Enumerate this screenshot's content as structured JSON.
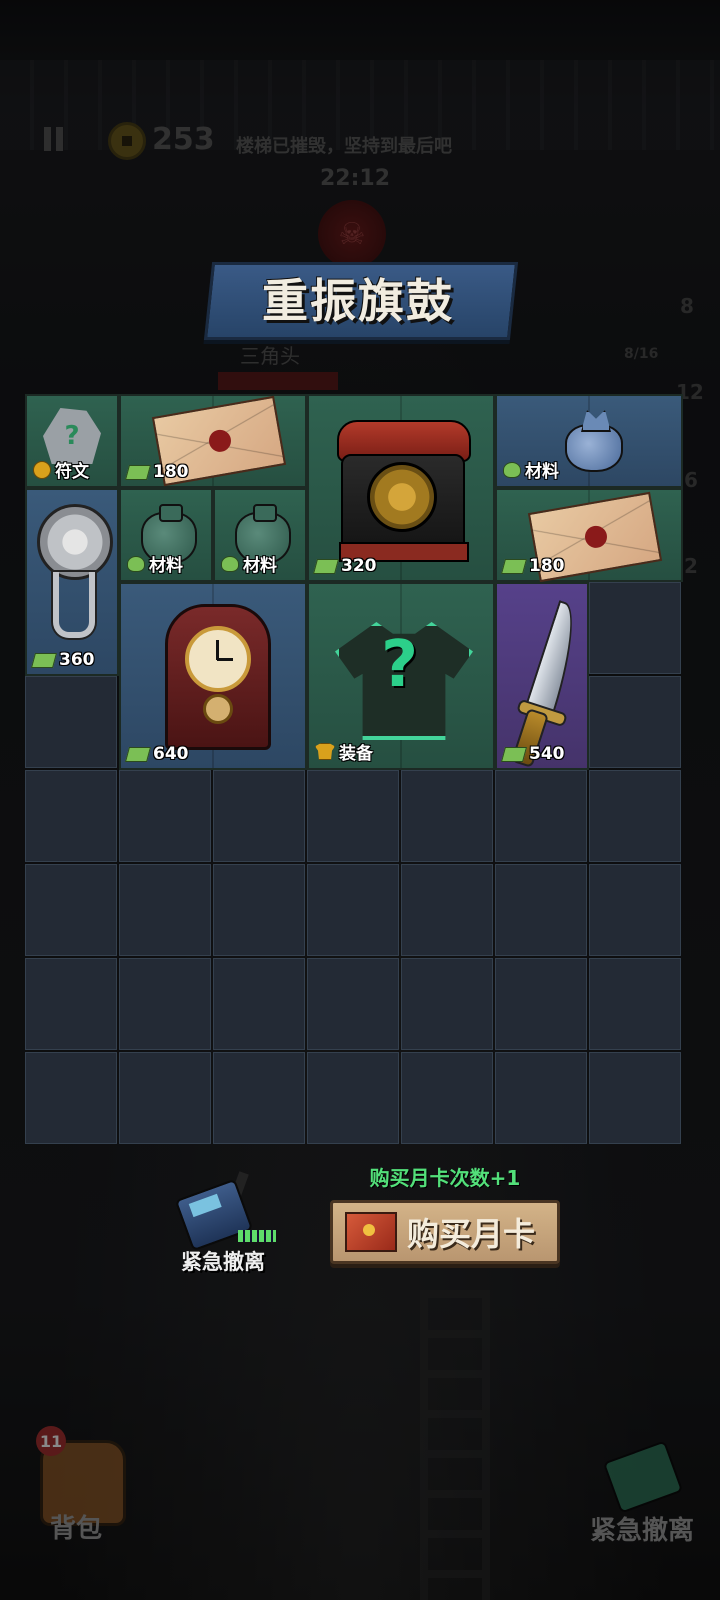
{
  "hud": {
    "coins": "253",
    "notice": "楼梯已摧毁，坚持到最后吧",
    "timer": "22:12",
    "enemy_name": "三角头",
    "side_counts": [
      "8",
      "8/16",
      "12",
      "6",
      "2"
    ]
  },
  "banner": {
    "title": "重振旗鼓"
  },
  "grid": {
    "columns": 7,
    "rows": 8
  },
  "items": {
    "rune": {
      "tag": "符文",
      "rarity": "green",
      "icon": "rune-stone-icon",
      "tag_icon": "gold-coin-icon"
    },
    "letter1": {
      "price": "180",
      "rarity": "green",
      "icon": "bloody-letter-icon",
      "tag_icon": "cash-icon"
    },
    "telephone": {
      "price": "320",
      "rarity": "green",
      "icon": "rotary-telephone-icon",
      "tag_icon": "cash-icon"
    },
    "bluebag": {
      "tag": "材料",
      "rarity": "blue",
      "icon": "blue-sack-icon",
      "tag_icon": "material-icon"
    },
    "bookmark": {
      "price": "360",
      "rarity": "blue",
      "icon": "silver-bookmark-icon",
      "tag_icon": "cash-icon"
    },
    "sack1": {
      "tag": "材料",
      "rarity": "green",
      "icon": "green-sack-icon",
      "tag_icon": "material-icon"
    },
    "sack2": {
      "tag": "材料",
      "rarity": "green",
      "icon": "green-sack-icon",
      "tag_icon": "material-icon"
    },
    "letter2": {
      "price": "180",
      "rarity": "green",
      "icon": "bloody-letter-icon",
      "tag_icon": "cash-icon"
    },
    "clock": {
      "price": "640",
      "rarity": "blue",
      "icon": "grandfather-clock-icon",
      "tag_icon": "cash-icon"
    },
    "equipment": {
      "tag": "装备",
      "rarity": "green",
      "icon": "mystery-shirt-icon",
      "tag_icon": "shirt-icon",
      "mark": "?"
    },
    "dagger": {
      "price": "540",
      "rarity": "purple",
      "icon": "curved-dagger-icon",
      "tag_icon": "cash-icon"
    }
  },
  "actions": {
    "evacuate_label": "紧急撤离",
    "promo": "购买月卡次数+1",
    "buy_monthly_card": "购买月卡"
  },
  "bottom_bar": {
    "backpack_label": "背包",
    "backpack_count": "11",
    "evacuate_label": "紧急撤离"
  },
  "colors": {
    "green_rarity": "#2f6250",
    "blue_rarity": "#3a5a7a",
    "purple_rarity": "#56418a",
    "promo_text": "#53e07a",
    "banner": "#3a5a86"
  }
}
